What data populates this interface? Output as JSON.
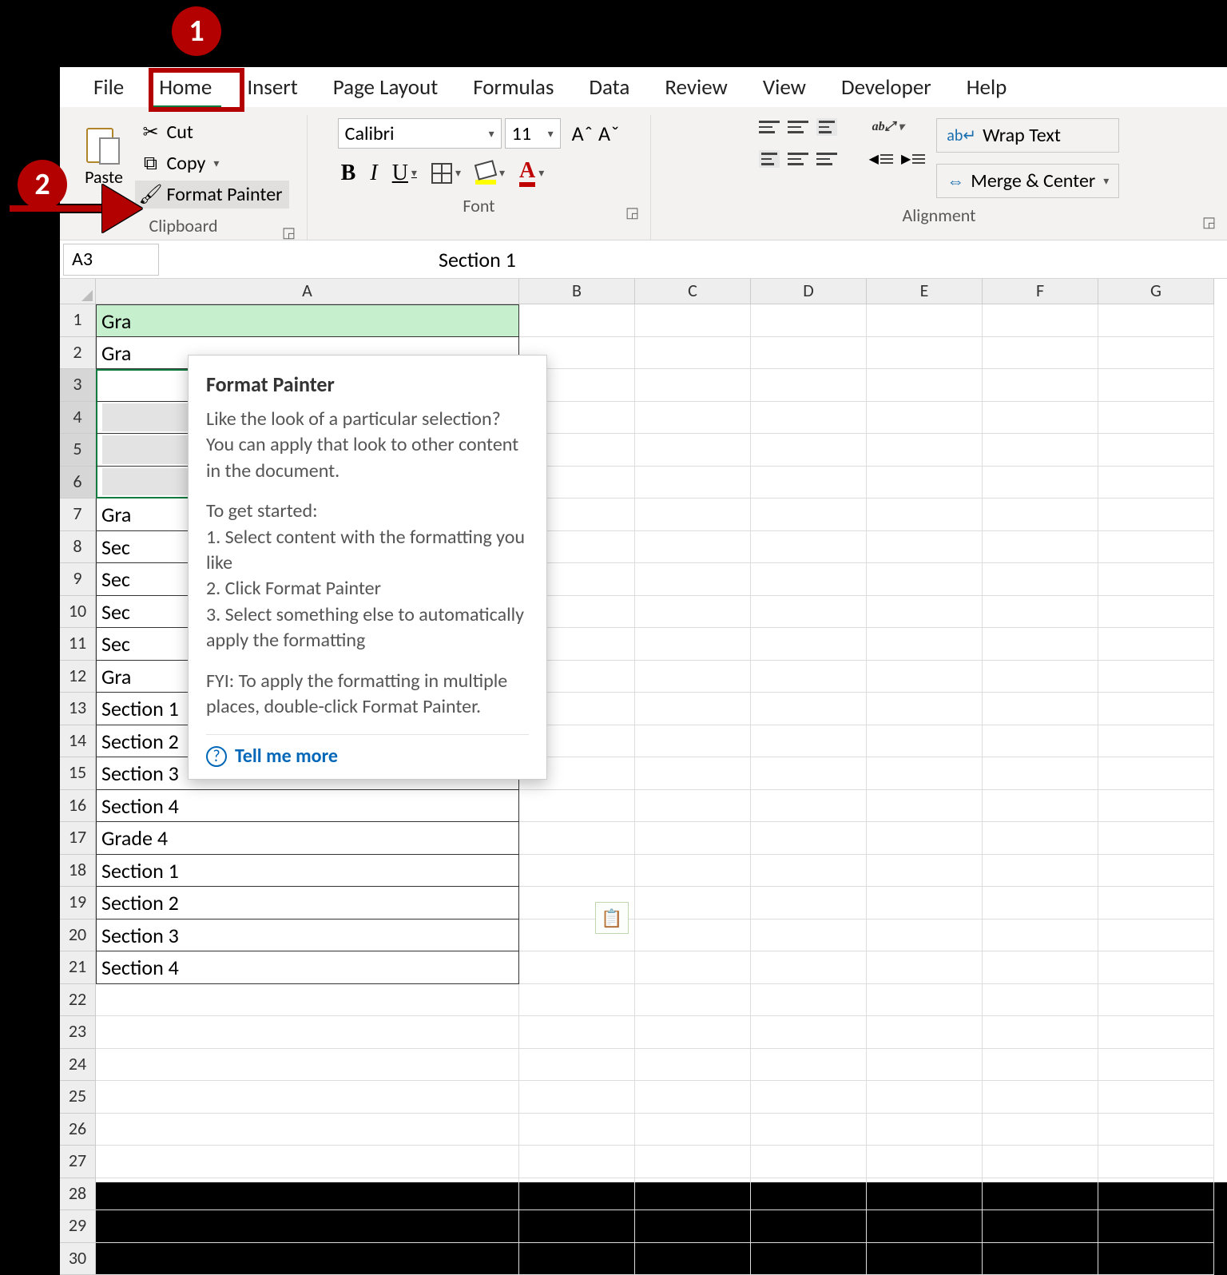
{
  "annotations": {
    "badge1": "1",
    "badge2": "2"
  },
  "tabs": {
    "file": "File",
    "home": "Home",
    "insert": "Insert",
    "page_layout": "Page Layout",
    "formulas": "Formulas",
    "data": "Data",
    "review": "Review",
    "view": "View",
    "developer": "Developer",
    "help": "Help"
  },
  "clipboard": {
    "paste": "Paste",
    "cut": "Cut",
    "copy": "Copy",
    "format_painter": "Format Painter",
    "group_label": "Clipboard"
  },
  "font": {
    "name": "Calibri",
    "size": "11",
    "group_label": "Font",
    "bold": "B",
    "italic": "I",
    "underline": "U",
    "fontcolor_letter": "A",
    "grow": "Aˆ",
    "shrink": "Aˇ"
  },
  "alignment": {
    "wrap": "Wrap Text",
    "merge": "Merge & Center",
    "group_label": "Alignment"
  },
  "namebox": "A3",
  "formula_bar": "Section 1",
  "columns": [
    "A",
    "B",
    "C",
    "D",
    "E",
    "F",
    "G"
  ],
  "cells": {
    "r1": "Gra",
    "r2": "Gra",
    "r7": "Gra",
    "r8": "Sec",
    "r9": "Sec",
    "r10": "Sec",
    "r11": "Sec",
    "r12": "Gra",
    "r13": "Section 1",
    "r14": "Section 2",
    "r15": "Section 3",
    "r16": "Section 4",
    "r17": "Grade 4",
    "r18": "Section 1",
    "r19": "Section 2",
    "r20": "Section 3",
    "r21": "Section 4"
  },
  "tooltip": {
    "title": "Format Painter",
    "p1": "Like the look of a particular selection? You can apply that look to other content in the document.",
    "p2": "To get started:",
    "l1": "1. Select content with the formatting you like",
    "l2": "2. Click Format Painter",
    "l3": "3. Select something else to automatically apply the formatting",
    "p3": "FYI: To apply the formatting in multiple places, double-click Format Painter.",
    "tell_more": "Tell me more"
  }
}
